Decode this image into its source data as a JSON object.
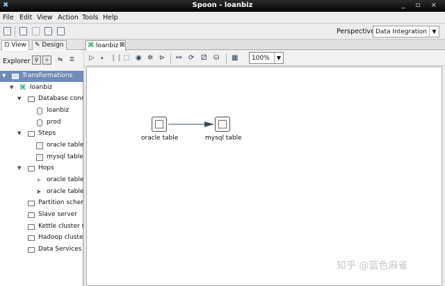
{
  "window": {
    "title": "Spoon - loanbiz",
    "controls": "_ ▫ ×"
  },
  "menu": [
    "File",
    "Edit",
    "View",
    "Action",
    "Tools",
    "Help"
  ],
  "perspective": {
    "label": "Perspective:",
    "value": "Data Integration"
  },
  "left_tabs": {
    "view": "View",
    "design": "Design"
  },
  "explorer": {
    "label": "Explorer"
  },
  "tree": {
    "transformations": "Transformations",
    "loanbiz": "loanbiz",
    "database_connections": "Database conn",
    "db_items": [
      "loanbiz",
      "prod"
    ],
    "steps": "Steps",
    "step_items": [
      "oracle table",
      "mysql table"
    ],
    "hops": "Hops",
    "hop_items": [
      "oracle table",
      "oracle table"
    ],
    "partition": "Partition schem",
    "slave": "Slave server",
    "kettle": "Kettle cluster s",
    "hadoop": "Hadoop cluster",
    "data_services": "Data Services"
  },
  "editor": {
    "tab_name": "loanbiz",
    "tab_close": "⊠",
    "zoom": "100%"
  },
  "canvas": {
    "step1": "oracle table",
    "step2": "mysql table"
  },
  "watermark": "知乎 @蓝色麻雀"
}
